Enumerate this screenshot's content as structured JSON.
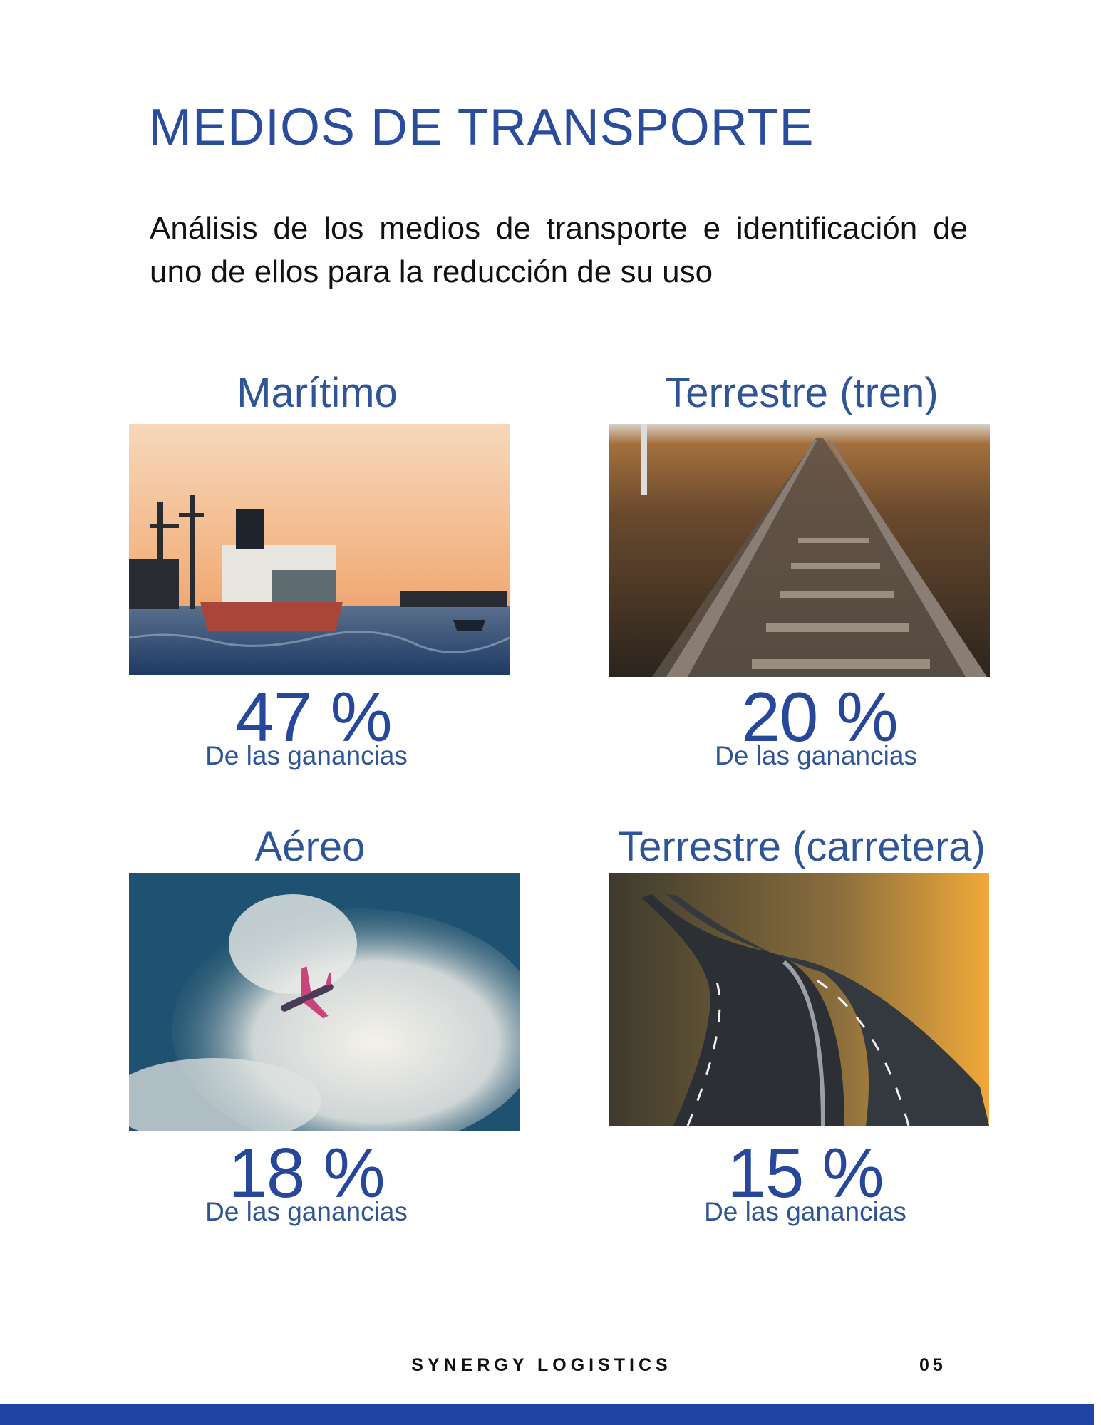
{
  "page": {
    "title": "MEDIOS DE TRANSPORTE",
    "intro": "Análisis de los medios de transporte e identificación de uno de ellos para la reducción de su uso"
  },
  "cards": [
    {
      "label": "Marítimo",
      "percent": "47 %",
      "caption": "De las ganancias",
      "image_icon": "cargo-ship-photo"
    },
    {
      "label": "Terrestre (tren)",
      "percent": "20 %",
      "caption": "De las ganancias",
      "image_icon": "railway-track-photo"
    },
    {
      "label": "Aéreo",
      "percent": "18 %",
      "caption": "De las ganancias",
      "image_icon": "airplane-sky-photo"
    },
    {
      "label": "Terrestre (carretera)",
      "percent": "15 %",
      "caption": "De las ganancias",
      "image_icon": "highway-road-photo"
    }
  ],
  "footer": {
    "brand": "SYNERGY LOGISTICS",
    "page_number": "05"
  },
  "colors": {
    "accent": "#2a4c9c",
    "bottom_bar": "#1f44a3",
    "body_text": "#111111"
  }
}
